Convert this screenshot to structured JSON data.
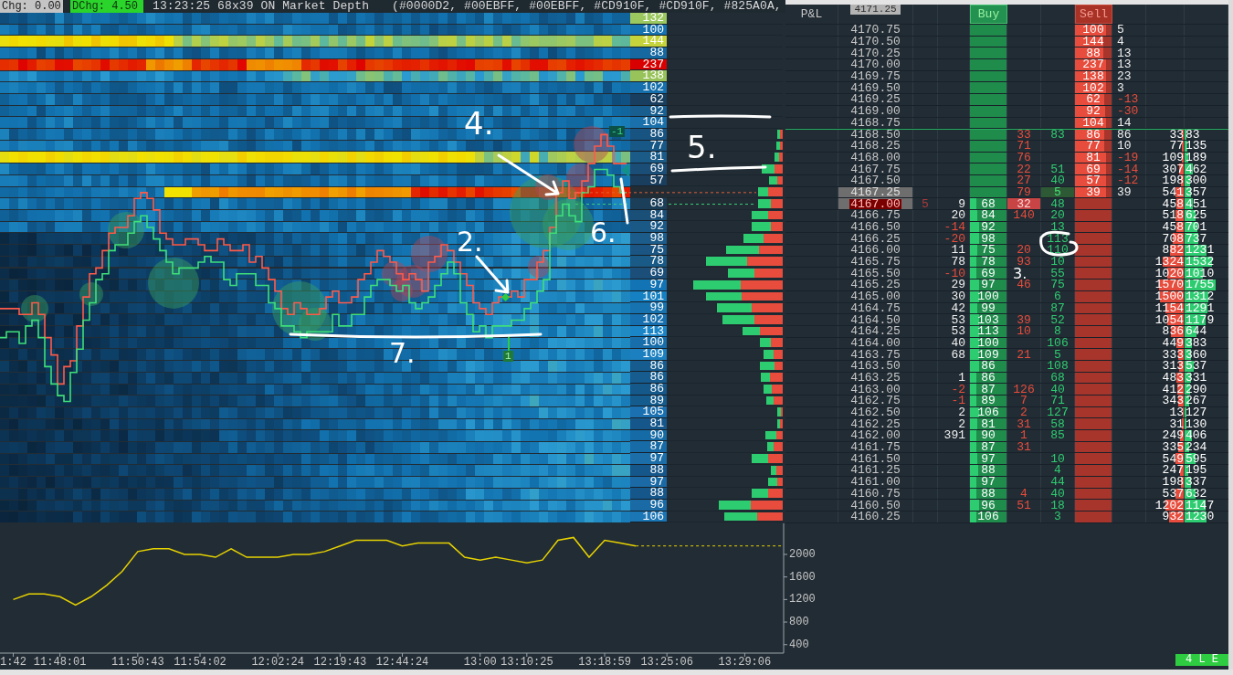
{
  "top_bar": {
    "change": "Chg: 0.00",
    "daily_change": "DChg: 4.50",
    "info": "13:23:25 68x39 ON Market Depth",
    "colors": "(#0000D2, #00EBFF, #00EBFF, #CD910F, #CD910F, #825A0A,"
  },
  "heatmap": {
    "levels": [
      {
        "kind": "value",
        "volume": "132",
        "color": "#9cc860"
      },
      {
        "kind": "value",
        "volume": "100",
        "color": "#1473b0"
      },
      {
        "kind": "value",
        "volume": "144",
        "color": "#c5d43a"
      },
      {
        "kind": "value",
        "volume": "88",
        "color": "#1568a0"
      },
      {
        "kind": "value",
        "volume": "237",
        "color": "#d80000"
      },
      {
        "kind": "value",
        "volume": "138",
        "color": "#98c35a"
      },
      {
        "kind": "value",
        "volume": "102",
        "color": "#1570ad"
      },
      {
        "kind": "value",
        "volume": "62",
        "color": "#183f5f"
      },
      {
        "kind": "value",
        "volume": "92",
        "color": "#185f90"
      },
      {
        "kind": "value",
        "volume": "104",
        "color": "#1a70aa"
      },
      {
        "kind": "value",
        "volume": "86",
        "color": "#175482"
      },
      {
        "kind": "value",
        "volume": "77",
        "color": "#175887"
      },
      {
        "kind": "value",
        "volume": "81",
        "color": "#1a5b88"
      },
      {
        "kind": "value",
        "volume": "69",
        "color": "#1b4e77"
      },
      {
        "kind": "value",
        "volume": "57",
        "color": "#1a3f5e"
      },
      {
        "kind": "gap"
      },
      {
        "kind": "value",
        "volume": "68",
        "color": "#1b3e59"
      },
      {
        "kind": "value",
        "volume": "84",
        "color": "#1a4f78"
      },
      {
        "kind": "value",
        "volume": "92",
        "color": "#1a5886"
      },
      {
        "kind": "value",
        "volume": "98",
        "color": "#1b5c8a"
      },
      {
        "kind": "value",
        "volume": "75",
        "color": "#1b5583"
      },
      {
        "kind": "value",
        "volume": "78",
        "color": "#1a5a86"
      },
      {
        "kind": "value",
        "volume": "69",
        "color": "#1b4f7a"
      },
      {
        "kind": "value",
        "volume": "97",
        "color": "#1374b5"
      },
      {
        "kind": "value",
        "volume": "101",
        "color": "#1580c2"
      },
      {
        "kind": "value",
        "volume": "99",
        "color": "#1673b0"
      },
      {
        "kind": "value",
        "volume": "102",
        "color": "#166fae"
      },
      {
        "kind": "value",
        "volume": "113",
        "color": "#1a86c8"
      },
      {
        "kind": "value",
        "volume": "100",
        "color": "#176eab"
      },
      {
        "kind": "value",
        "volume": "109",
        "color": "#1c80c0"
      },
      {
        "kind": "value",
        "volume": "86",
        "color": "#165c8e"
      },
      {
        "kind": "value",
        "volume": "86",
        "color": "#165c8e"
      },
      {
        "kind": "value",
        "volume": "86",
        "color": "#15598a"
      },
      {
        "kind": "value",
        "volume": "89",
        "color": "#155c8e"
      },
      {
        "kind": "value",
        "volume": "105",
        "color": "#1a70b0"
      },
      {
        "kind": "value",
        "volume": "81",
        "color": "#16578b"
      },
      {
        "kind": "value",
        "volume": "90",
        "color": "#156ba6"
      },
      {
        "kind": "value",
        "volume": "87",
        "color": "#176ba6"
      },
      {
        "kind": "value",
        "volume": "97",
        "color": "#1b6ea8"
      },
      {
        "kind": "value",
        "volume": "88",
        "color": "#16578b"
      },
      {
        "kind": "value",
        "volume": "97",
        "color": "#1b6aa5"
      },
      {
        "kind": "value",
        "volume": "88",
        "color": "#16578b"
      },
      {
        "kind": "value",
        "volume": "96",
        "color": "#1a6aa5"
      },
      {
        "kind": "value",
        "volume": "106",
        "color": "#1b76b6"
      }
    ],
    "markers": [
      {
        "kind": "position",
        "text": "-1"
      },
      {
        "kind": "fill",
        "text": "1"
      }
    ]
  },
  "annotations": [
    {
      "text": "4."
    },
    {
      "text": "5."
    },
    {
      "text": "6."
    },
    {
      "text": "2."
    },
    {
      "text": "3."
    },
    {
      "text": "7."
    }
  ],
  "ladder": {
    "header": {
      "pnl": "P&L",
      "top_price": "4171.25",
      "buy": "Buy",
      "sell": "Sell"
    },
    "rows": [
      {
        "price": "4170.75",
        "highlighted": false,
        "last_trade": false,
        "line_above": false,
        "sell": {
          "text": "100",
          "level": 0.84
        },
        "column_9": {
          "text": "5",
          "negative": false
        }
      },
      {
        "price": "4170.50",
        "highlighted": false,
        "last_trade": false,
        "line_above": false,
        "sell": {
          "text": "144",
          "level": 0.78
        },
        "column_9": {
          "text": "4",
          "negative": false
        }
      },
      {
        "price": "4170.25",
        "highlighted": false,
        "last_trade": false,
        "line_above": false,
        "sell": {
          "text": "88",
          "level": 0.77
        },
        "column_9": {
          "text": "13",
          "negative": false
        }
      },
      {
        "price": "4170.00",
        "highlighted": false,
        "last_trade": false,
        "line_above": false,
        "sell": {
          "text": "237",
          "level": 0.84
        },
        "column_9": {
          "text": "13",
          "negative": false
        }
      },
      {
        "price": "4169.75",
        "highlighted": false,
        "last_trade": false,
        "line_above": false,
        "sell": {
          "text": "138",
          "level": 0.84
        },
        "column_9": {
          "text": "23",
          "negative": false
        }
      },
      {
        "price": "4169.50",
        "highlighted": false,
        "last_trade": false,
        "line_above": false,
        "sell": {
          "text": "102",
          "level": 0.84
        },
        "column_9": {
          "text": "3",
          "negative": false
        }
      },
      {
        "price": "4169.25",
        "highlighted": false,
        "last_trade": false,
        "line_above": false,
        "sell": {
          "text": "62",
          "level": 0.8
        },
        "column_9": {
          "text": "-13",
          "negative": true
        }
      },
      {
        "price": "4169.00",
        "highlighted": false,
        "last_trade": false,
        "line_above": false,
        "sell": {
          "text": "92",
          "level": 0.82
        },
        "column_9": {
          "text": "-30",
          "negative": true
        }
      },
      {
        "price": "4168.75",
        "highlighted": false,
        "last_trade": false,
        "line_above": false,
        "sell": {
          "text": "104",
          "level": 0.84
        },
        "column_9": {
          "text": "14",
          "negative": false
        }
      },
      {
        "price": "4168.50",
        "highlighted": false,
        "last_trade": false,
        "line_above": true,
        "column_6": {
          "text": "33",
          "highlighted": false
        },
        "column_7": {
          "text": "83",
          "highlighted": false
        },
        "sell": {
          "text": "86",
          "level": 0.8
        },
        "column_9": {
          "text": "86",
          "negative": false
        },
        "column_10": {
          "text": "33",
          "level": 0.04
        },
        "column_11": {
          "text": "83",
          "level": 0.04
        }
      },
      {
        "price": "4168.25",
        "highlighted": false,
        "last_trade": false,
        "line_above": false,
        "column_6": {
          "text": "71",
          "highlighted": false
        },
        "sell": {
          "text": "77",
          "level": 0.8
        },
        "column_9": {
          "text": "10",
          "negative": false
        },
        "column_10": {
          "text": "77",
          "level": 0.04
        },
        "column_11": {
          "text": "135",
          "level": 0.06
        }
      },
      {
        "price": "4168.00",
        "highlighted": false,
        "last_trade": false,
        "line_above": false,
        "column_6": {
          "text": "76",
          "highlighted": false
        },
        "sell": {
          "text": "81",
          "level": 0.84
        },
        "column_9": {
          "text": "-19",
          "negative": true
        },
        "column_10": {
          "text": "109",
          "level": 0.05
        },
        "column_11": {
          "text": "189",
          "level": 0.08
        }
      },
      {
        "price": "4167.75",
        "highlighted": false,
        "last_trade": false,
        "line_above": false,
        "column_6": {
          "text": "22",
          "highlighted": false
        },
        "column_7": {
          "text": "51",
          "highlighted": false
        },
        "sell": {
          "text": "69",
          "level": 0.84
        },
        "column_9": {
          "text": "-14",
          "negative": true
        },
        "column_10": {
          "text": "307",
          "level": 0.13
        },
        "column_11": {
          "text": "462",
          "level": 0.19
        }
      },
      {
        "price": "4167.50",
        "highlighted": false,
        "last_trade": false,
        "line_above": false,
        "column_6": {
          "text": "27",
          "highlighted": false
        },
        "column_7": {
          "text": "40",
          "highlighted": false
        },
        "sell": {
          "text": "57",
          "level": 0.84
        },
        "column_9": {
          "text": "-12",
          "negative": true
        },
        "column_10": {
          "text": "198",
          "level": 0.08
        },
        "column_11": {
          "text": "300",
          "level": 0.13
        }
      },
      {
        "price": "4167.25",
        "highlighted": true,
        "last_trade": false,
        "line_above": false,
        "column_6": {
          "text": "79",
          "highlighted": false
        },
        "column_7": {
          "text": "5",
          "highlighted": true
        },
        "sell": {
          "text": "39",
          "level": 0.84
        },
        "column_9": {
          "text": "39",
          "negative": false
        },
        "column_10": {
          "text": "541",
          "level": 0.23
        },
        "column_11": {
          "text": "357",
          "level": 0.15
        }
      },
      {
        "price": "4167.00",
        "highlighted": true,
        "last_trade": true,
        "line_above": false,
        "column_3": "5",
        "column_4": {
          "text": "9",
          "negative": false
        },
        "buy": {
          "text": "68",
          "level": 0.18
        },
        "column_6": {
          "text": "32",
          "highlighted": true
        },
        "column_7": {
          "text": "48",
          "highlighted": false
        },
        "column_10": {
          "text": "458",
          "level": 0.19
        },
        "column_11": {
          "text": "451",
          "level": 0.19
        }
      },
      {
        "price": "4166.75",
        "highlighted": false,
        "last_trade": false,
        "line_above": false,
        "column_4": {
          "text": "20",
          "negative": false
        },
        "buy": {
          "text": "84",
          "level": 0.2
        },
        "column_6": {
          "text": "140",
          "highlighted": false
        },
        "column_7": {
          "text": "20",
          "highlighted": false
        },
        "column_10": {
          "text": "518",
          "level": 0.22
        },
        "column_11": {
          "text": "625",
          "level": 0.26
        }
      },
      {
        "price": "4166.50",
        "highlighted": false,
        "last_trade": false,
        "line_above": false,
        "column_4": {
          "text": "-14",
          "negative": true
        },
        "buy": {
          "text": "92",
          "level": 0.25
        },
        "column_7": {
          "text": "13",
          "highlighted": false
        },
        "column_10": {
          "text": "458",
          "level": 0.19
        },
        "column_11": {
          "text": "701",
          "level": 0.29
        }
      },
      {
        "price": "4166.25",
        "highlighted": false,
        "last_trade": false,
        "line_above": false,
        "column_4": {
          "text": "-20",
          "negative": true
        },
        "buy": {
          "text": "98",
          "level": 0.25
        },
        "column_7": {
          "text": "113",
          "highlighted": false
        },
        "column_10": {
          "text": "708",
          "level": 0.3
        },
        "column_11": {
          "text": "737",
          "level": 0.31
        }
      },
      {
        "price": "4166.00",
        "highlighted": false,
        "last_trade": false,
        "line_above": false,
        "column_4": {
          "text": "11",
          "negative": false
        },
        "buy": {
          "text": "75",
          "level": 0.2
        },
        "column_6": {
          "text": "20",
          "highlighted": false
        },
        "column_7": {
          "text": "110",
          "highlighted": false
        },
        "column_10": {
          "text": "882",
          "level": 0.37
        },
        "column_11": {
          "text": "1231",
          "level": 0.51
        }
      },
      {
        "price": "4165.75",
        "highlighted": false,
        "last_trade": false,
        "line_above": false,
        "column_4": {
          "text": "78",
          "negative": false
        },
        "buy": {
          "text": "78",
          "level": 0.18
        },
        "column_6": {
          "text": "93",
          "highlighted": false
        },
        "column_7": {
          "text": "10",
          "highlighted": false
        },
        "column_10": {
          "text": "1324",
          "level": 0.55
        },
        "column_11": {
          "text": "1532",
          "level": 0.64
        }
      },
      {
        "price": "4165.50",
        "highlighted": false,
        "last_trade": false,
        "line_above": false,
        "column_4": {
          "text": "-10",
          "negative": true
        },
        "buy": {
          "text": "69",
          "level": 0.18
        },
        "column_7": {
          "text": "55",
          "highlighted": false
        },
        "column_10": {
          "text": "1020",
          "level": 0.43
        },
        "column_11": {
          "text": "1010",
          "level": 0.42
        }
      },
      {
        "price": "4165.25",
        "highlighted": false,
        "last_trade": false,
        "line_above": false,
        "column_4": {
          "text": "29",
          "negative": false
        },
        "buy": {
          "text": "97",
          "level": 0.25
        },
        "column_6": {
          "text": "46",
          "highlighted": false
        },
        "column_7": {
          "text": "75",
          "highlighted": false
        },
        "column_10": {
          "text": "1570",
          "level": 0.65
        },
        "column_11": {
          "text": "1755",
          "level": 0.73
        }
      },
      {
        "price": "4165.00",
        "highlighted": false,
        "last_trade": false,
        "line_above": false,
        "column_4": {
          "text": "30",
          "negative": false
        },
        "buy": {
          "text": "100",
          "level": 0.25
        },
        "column_7": {
          "text": "6",
          "highlighted": false
        },
        "column_10": {
          "text": "1500",
          "level": 0.63
        },
        "column_11": {
          "text": "1312",
          "level": 0.55
        }
      },
      {
        "price": "4164.75",
        "highlighted": false,
        "last_trade": false,
        "line_above": false,
        "column_4": {
          "text": "42",
          "negative": false
        },
        "buy": {
          "text": "99",
          "level": 0.2
        },
        "column_7": {
          "text": "87",
          "highlighted": false
        },
        "column_10": {
          "text": "1154",
          "level": 0.48
        },
        "column_11": {
          "text": "1291",
          "level": 0.54
        }
      },
      {
        "price": "4164.50",
        "highlighted": false,
        "last_trade": false,
        "line_above": false,
        "column_4": {
          "text": "53",
          "negative": false
        },
        "buy": {
          "text": "103",
          "level": 0.25
        },
        "column_6": {
          "text": "39",
          "highlighted": false
        },
        "column_7": {
          "text": "52",
          "highlighted": false
        },
        "column_10": {
          "text": "1054",
          "level": 0.44
        },
        "column_11": {
          "text": "1179",
          "level": 0.49
        }
      },
      {
        "price": "4164.25",
        "highlighted": false,
        "last_trade": false,
        "line_above": false,
        "column_4": {
          "text": "53",
          "negative": false
        },
        "buy": {
          "text": "113",
          "level": 0.25
        },
        "column_6": {
          "text": "10",
          "highlighted": false
        },
        "column_7": {
          "text": "8",
          "highlighted": false
        },
        "column_10": {
          "text": "836",
          "level": 0.35
        },
        "column_11": {
          "text": "644",
          "level": 0.27
        }
      },
      {
        "price": "4164.00",
        "highlighted": false,
        "last_trade": false,
        "line_above": false,
        "column_4": {
          "text": "40",
          "negative": false
        },
        "buy": {
          "text": "100",
          "level": 0.25
        },
        "column_7": {
          "text": "106",
          "highlighted": false
        },
        "column_10": {
          "text": "449",
          "level": 0.19
        },
        "column_11": {
          "text": "383",
          "level": 0.16
        }
      },
      {
        "price": "4163.75",
        "highlighted": false,
        "last_trade": false,
        "line_above": false,
        "column_4": {
          "text": "68",
          "negative": false
        },
        "buy": {
          "text": "109",
          "level": 0.25
        },
        "column_6": {
          "text": "21",
          "highlighted": false
        },
        "column_7": {
          "text": "5",
          "highlighted": false
        },
        "column_10": {
          "text": "333",
          "level": 0.14
        },
        "column_11": {
          "text": "360",
          "level": 0.15
        }
      },
      {
        "price": "4163.50",
        "highlighted": false,
        "last_trade": false,
        "line_above": false,
        "buy": {
          "text": "86",
          "level": 0.25
        },
        "column_7": {
          "text": "108",
          "highlighted": false
        },
        "column_10": {
          "text": "313",
          "level": 0.13
        },
        "column_11": {
          "text": "537",
          "level": 0.22
        }
      },
      {
        "price": "4163.25",
        "highlighted": false,
        "last_trade": false,
        "line_above": false,
        "column_4": {
          "text": "1",
          "negative": false
        },
        "buy": {
          "text": "86",
          "level": 0.18
        },
        "column_7": {
          "text": "68",
          "highlighted": false
        },
        "column_10": {
          "text": "483",
          "level": 0.2
        },
        "column_11": {
          "text": "331",
          "level": 0.14
        }
      },
      {
        "price": "4163.00",
        "highlighted": false,
        "last_trade": false,
        "line_above": false,
        "column_4": {
          "text": "-2",
          "negative": true
        },
        "buy": {
          "text": "87",
          "level": 0.18
        },
        "column_6": {
          "text": "126",
          "highlighted": false
        },
        "column_7": {
          "text": "40",
          "highlighted": false
        },
        "column_10": {
          "text": "412",
          "level": 0.17
        },
        "column_11": {
          "text": "290",
          "level": 0.12
        }
      },
      {
        "price": "4162.75",
        "highlighted": false,
        "last_trade": false,
        "line_above": false,
        "column_4": {
          "text": "-1",
          "negative": true
        },
        "buy": {
          "text": "89",
          "level": 0.18
        },
        "column_6": {
          "text": "7",
          "highlighted": false
        },
        "column_7": {
          "text": "71",
          "highlighted": false
        },
        "column_10": {
          "text": "343",
          "level": 0.14
        },
        "column_11": {
          "text": "267",
          "level": 0.11
        }
      },
      {
        "price": "4162.50",
        "highlighted": false,
        "last_trade": false,
        "line_above": false,
        "column_4": {
          "text": "2",
          "negative": false
        },
        "buy": {
          "text": "106",
          "level": 0.25
        },
        "column_6": {
          "text": "2",
          "highlighted": false
        },
        "column_7": {
          "text": "127",
          "highlighted": false
        },
        "column_10": {
          "text": "13",
          "level": 0.03
        },
        "column_11": {
          "text": "127",
          "level": 0.05
        }
      },
      {
        "price": "4162.25",
        "highlighted": false,
        "last_trade": false,
        "line_above": false,
        "column_4": {
          "text": "2",
          "negative": false
        },
        "buy": {
          "text": "81",
          "level": 0.2
        },
        "column_6": {
          "text": "31",
          "highlighted": false
        },
        "column_7": {
          "text": "58",
          "highlighted": false
        },
        "column_10": {
          "text": "31",
          "level": 0.04
        },
        "column_11": {
          "text": "130",
          "level": 0.05
        }
      },
      {
        "price": "4162.00",
        "highlighted": false,
        "last_trade": false,
        "line_above": false,
        "column_4": {
          "text": "391",
          "negative": false
        },
        "buy": {
          "text": "90",
          "level": 0.18
        },
        "column_6": {
          "text": "1",
          "highlighted": false
        },
        "column_7": {
          "text": "85",
          "highlighted": false
        },
        "column_10": {
          "text": "249",
          "level": 0.1
        },
        "column_11": {
          "text": "406",
          "level": 0.17
        }
      },
      {
        "price": "4161.75",
        "highlighted": false,
        "last_trade": false,
        "line_above": false,
        "buy": {
          "text": "87",
          "level": 0.18
        },
        "column_6": {
          "text": "31",
          "highlighted": false
        },
        "column_10": {
          "text": "335",
          "level": 0.14
        },
        "column_11": {
          "text": "234",
          "level": 0.1
        }
      },
      {
        "price": "4161.50",
        "highlighted": false,
        "last_trade": false,
        "line_above": false,
        "buy": {
          "text": "97",
          "level": 0.2
        },
        "column_7": {
          "text": "10",
          "highlighted": false
        },
        "column_10": {
          "text": "549",
          "level": 0.23
        },
        "column_11": {
          "text": "595",
          "level": 0.25
        }
      },
      {
        "price": "4161.25",
        "highlighted": false,
        "last_trade": false,
        "line_above": false,
        "buy": {
          "text": "88",
          "level": 0.22
        },
        "column_7": {
          "text": "4",
          "highlighted": false
        },
        "column_10": {
          "text": "247",
          "level": 0.1
        },
        "column_11": {
          "text": "195",
          "level": 0.08
        }
      },
      {
        "price": "4161.00",
        "highlighted": false,
        "last_trade": false,
        "line_above": false,
        "buy": {
          "text": "97",
          "level": 0.18
        },
        "column_7": {
          "text": "44",
          "highlighted": false
        },
        "column_10": {
          "text": "198",
          "level": 0.08
        },
        "column_11": {
          "text": "337",
          "level": 0.14
        }
      },
      {
        "price": "4160.75",
        "highlighted": false,
        "last_trade": false,
        "line_above": false,
        "buy": {
          "text": "88",
          "level": 0.18
        },
        "column_6": {
          "text": "4",
          "highlighted": false
        },
        "column_7": {
          "text": "40",
          "highlighted": false
        },
        "column_10": {
          "text": "537",
          "level": 0.22
        },
        "column_11": {
          "text": "632",
          "level": 0.26
        }
      },
      {
        "price": "4160.50",
        "highlighted": false,
        "last_trade": false,
        "line_above": false,
        "buy": {
          "text": "96",
          "level": 0.25
        },
        "column_6": {
          "text": "51",
          "highlighted": false
        },
        "column_7": {
          "text": "18",
          "highlighted": false
        },
        "column_10": {
          "text": "1202",
          "level": 0.5
        },
        "column_11": {
          "text": "1147",
          "level": 0.48
        }
      },
      {
        "price": "4160.25",
        "highlighted": false,
        "last_trade": false,
        "line_above": false,
        "buy": {
          "text": "106",
          "level": 0.18
        },
        "column_7": {
          "text": "3",
          "highlighted": false
        },
        "column_10": {
          "text": "932",
          "level": 0.39
        },
        "column_11": {
          "text": "1230",
          "level": 0.51
        }
      }
    ]
  },
  "lower_chart": {
    "chart_data": {
      "type": "line",
      "categories": [
        "1:42",
        null,
        null,
        "11:48:01",
        null,
        null,
        null,
        null,
        "11:50:43",
        null,
        null,
        null,
        "11:54:02",
        null,
        null,
        null,
        null,
        "12:02:24",
        null,
        null,
        null,
        "12:19:43",
        null,
        null,
        null,
        "12:44:24",
        null,
        null,
        null,
        null,
        "13:00",
        null,
        null,
        "13:10:25",
        null,
        null,
        null,
        null,
        "13:18:59",
        null,
        null,
        null,
        "13:25:06",
        null,
        null,
        null,
        null,
        "13:29:06",
        null,
        null
      ],
      "series": [
        {
          "color": "#e6d200",
          "values": [
            1200,
            1300,
            1300,
            1250,
            1100,
            1250,
            1450,
            1700,
            2050,
            2100,
            2100,
            2000,
            2000,
            1950,
            2100,
            1950,
            1950,
            1950,
            2000,
            2000,
            2050,
            2150,
            2250,
            2250,
            2250,
            2150,
            2200,
            2200,
            2200,
            1950,
            1900,
            1950,
            1900,
            1850,
            1900,
            2250,
            2300,
            1950,
            2250,
            2200,
            2150,
            null,
            null,
            null,
            null,
            null,
            null,
            null,
            null,
            null
          ]
        }
      ],
      "ylim": [
        250,
        2550
      ],
      "yticks": [
        400,
        800,
        1200,
        1600,
        2000
      ]
    }
  },
  "status_badge": "4 L E"
}
